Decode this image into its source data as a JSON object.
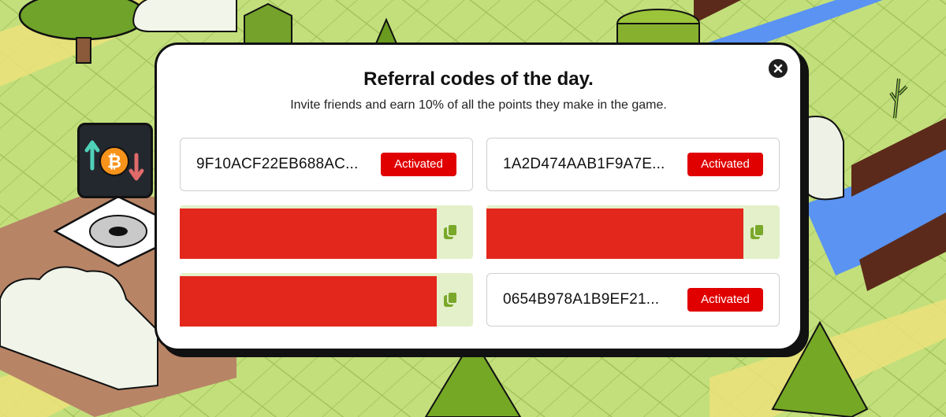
{
  "modal": {
    "title": "Referral codes of the day.",
    "subtitle": "Invite friends and earn 10% of all the points they make in the game."
  },
  "codes": [
    {
      "code": "9F10ACF22EB688AC...",
      "status": "Activated"
    },
    {
      "code": "1A2D474AAB1F9A7E...",
      "status": "Activated"
    },
    {
      "code": "",
      "status": ""
    },
    {
      "code": "",
      "status": ""
    },
    {
      "code": "",
      "status": ""
    },
    {
      "code": "0654B978A1B9EF21...",
      "status": "Activated"
    }
  ],
  "icons": {
    "close": "close-icon",
    "copy": "copy-icon",
    "crypto": "bitcoin-exchange-icon"
  },
  "colors": {
    "activated_badge": "#e00000",
    "redacted": "#e3271c",
    "copy_icon": "#7aa82a",
    "modal_bg": "#ffffff"
  }
}
